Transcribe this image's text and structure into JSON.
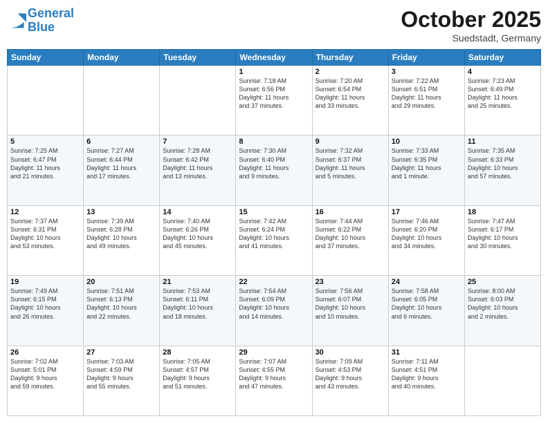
{
  "header": {
    "logo_line1": "General",
    "logo_line2": "Blue",
    "month": "October 2025",
    "location": "Suedstadt, Germany"
  },
  "weekdays": [
    "Sunday",
    "Monday",
    "Tuesday",
    "Wednesday",
    "Thursday",
    "Friday",
    "Saturday"
  ],
  "weeks": [
    [
      {
        "day": "",
        "info": ""
      },
      {
        "day": "",
        "info": ""
      },
      {
        "day": "",
        "info": ""
      },
      {
        "day": "1",
        "info": "Sunrise: 7:18 AM\nSunset: 6:56 PM\nDaylight: 11 hours\nand 37 minutes."
      },
      {
        "day": "2",
        "info": "Sunrise: 7:20 AM\nSunset: 6:54 PM\nDaylight: 11 hours\nand 33 minutes."
      },
      {
        "day": "3",
        "info": "Sunrise: 7:22 AM\nSunset: 6:51 PM\nDaylight: 11 hours\nand 29 minutes."
      },
      {
        "day": "4",
        "info": "Sunrise: 7:23 AM\nSunset: 6:49 PM\nDaylight: 11 hours\nand 25 minutes."
      }
    ],
    [
      {
        "day": "5",
        "info": "Sunrise: 7:25 AM\nSunset: 6:47 PM\nDaylight: 11 hours\nand 21 minutes."
      },
      {
        "day": "6",
        "info": "Sunrise: 7:27 AM\nSunset: 6:44 PM\nDaylight: 11 hours\nand 17 minutes."
      },
      {
        "day": "7",
        "info": "Sunrise: 7:28 AM\nSunset: 6:42 PM\nDaylight: 11 hours\nand 13 minutes."
      },
      {
        "day": "8",
        "info": "Sunrise: 7:30 AM\nSunset: 6:40 PM\nDaylight: 11 hours\nand 9 minutes."
      },
      {
        "day": "9",
        "info": "Sunrise: 7:32 AM\nSunset: 6:37 PM\nDaylight: 11 hours\nand 5 minutes."
      },
      {
        "day": "10",
        "info": "Sunrise: 7:33 AM\nSunset: 6:35 PM\nDaylight: 11 hours\nand 1 minute."
      },
      {
        "day": "11",
        "info": "Sunrise: 7:35 AM\nSunset: 6:33 PM\nDaylight: 10 hours\nand 57 minutes."
      }
    ],
    [
      {
        "day": "12",
        "info": "Sunrise: 7:37 AM\nSunset: 6:31 PM\nDaylight: 10 hours\nand 53 minutes."
      },
      {
        "day": "13",
        "info": "Sunrise: 7:39 AM\nSunset: 6:28 PM\nDaylight: 10 hours\nand 49 minutes."
      },
      {
        "day": "14",
        "info": "Sunrise: 7:40 AM\nSunset: 6:26 PM\nDaylight: 10 hours\nand 45 minutes."
      },
      {
        "day": "15",
        "info": "Sunrise: 7:42 AM\nSunset: 6:24 PM\nDaylight: 10 hours\nand 41 minutes."
      },
      {
        "day": "16",
        "info": "Sunrise: 7:44 AM\nSunset: 6:22 PM\nDaylight: 10 hours\nand 37 minutes."
      },
      {
        "day": "17",
        "info": "Sunrise: 7:46 AM\nSunset: 6:20 PM\nDaylight: 10 hours\nand 34 minutes."
      },
      {
        "day": "18",
        "info": "Sunrise: 7:47 AM\nSunset: 6:17 PM\nDaylight: 10 hours\nand 30 minutes."
      }
    ],
    [
      {
        "day": "19",
        "info": "Sunrise: 7:49 AM\nSunset: 6:15 PM\nDaylight: 10 hours\nand 26 minutes."
      },
      {
        "day": "20",
        "info": "Sunrise: 7:51 AM\nSunset: 6:13 PM\nDaylight: 10 hours\nand 22 minutes."
      },
      {
        "day": "21",
        "info": "Sunrise: 7:53 AM\nSunset: 6:11 PM\nDaylight: 10 hours\nand 18 minutes."
      },
      {
        "day": "22",
        "info": "Sunrise: 7:54 AM\nSunset: 6:09 PM\nDaylight: 10 hours\nand 14 minutes."
      },
      {
        "day": "23",
        "info": "Sunrise: 7:56 AM\nSunset: 6:07 PM\nDaylight: 10 hours\nand 10 minutes."
      },
      {
        "day": "24",
        "info": "Sunrise: 7:58 AM\nSunset: 6:05 PM\nDaylight: 10 hours\nand 6 minutes."
      },
      {
        "day": "25",
        "info": "Sunrise: 8:00 AM\nSunset: 6:03 PM\nDaylight: 10 hours\nand 2 minutes."
      }
    ],
    [
      {
        "day": "26",
        "info": "Sunrise: 7:02 AM\nSunset: 5:01 PM\nDaylight: 9 hours\nand 59 minutes."
      },
      {
        "day": "27",
        "info": "Sunrise: 7:03 AM\nSunset: 4:59 PM\nDaylight: 9 hours\nand 55 minutes."
      },
      {
        "day": "28",
        "info": "Sunrise: 7:05 AM\nSunset: 4:57 PM\nDaylight: 9 hours\nand 51 minutes."
      },
      {
        "day": "29",
        "info": "Sunrise: 7:07 AM\nSunset: 4:55 PM\nDaylight: 9 hours\nand 47 minutes."
      },
      {
        "day": "30",
        "info": "Sunrise: 7:09 AM\nSunset: 4:53 PM\nDaylight: 9 hours\nand 43 minutes."
      },
      {
        "day": "31",
        "info": "Sunrise: 7:11 AM\nSunset: 4:51 PM\nDaylight: 9 hours\nand 40 minutes."
      },
      {
        "day": "",
        "info": ""
      }
    ]
  ]
}
